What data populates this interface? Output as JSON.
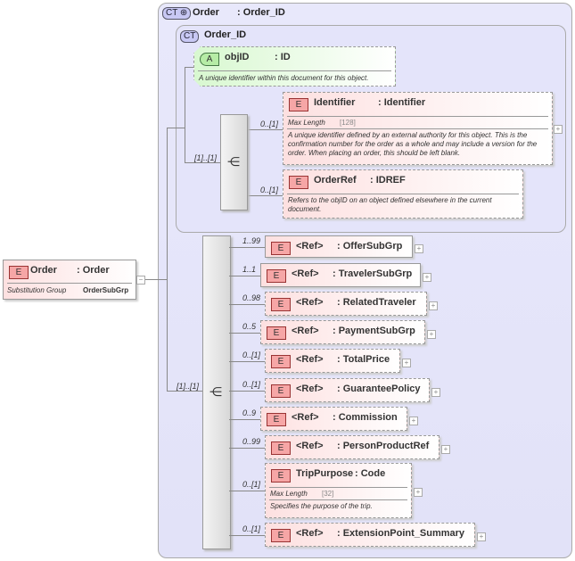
{
  "root": {
    "badge": "E",
    "name": "Order",
    "type": ": Order",
    "subst_label": "Substitution Group",
    "subst_value": "OrderSubGrp"
  },
  "outer_ct": {
    "badge": "CT",
    "name": "Order",
    "type": ": Order_ID"
  },
  "inner_ct": {
    "badge": "CT",
    "name": "Order_ID"
  },
  "attribute": {
    "badge": "A",
    "name": "objID",
    "type": ": ID",
    "doc": "A unique identifier within this document for this object."
  },
  "upper_sequence": {
    "cardinality": "[1]..[1]"
  },
  "identifier": {
    "badge": "E",
    "name": "Identifier",
    "type": ": Identifier",
    "cardinality": "0..[1]",
    "facet_label": "Max Length",
    "facet_value": "[128]",
    "doc": "A unique identifier defined by an external authority for this object.  This is the confirmation number for the order as a whole and may include a version for the order.  When placing an order, this should be left blank."
  },
  "orderref": {
    "badge": "E",
    "name": "OrderRef",
    "type": ": IDREF",
    "cardinality": "0..[1]",
    "doc": "Refers to the objID on an object defined elsewhere in the current document."
  },
  "lower_sequence": {
    "cardinality": "[1]..[1]"
  },
  "items": [
    {
      "name": "<Ref>",
      "type": ": OfferSubGrp",
      "cardinality": "1..99",
      "solid": true
    },
    {
      "name": "<Ref>",
      "type": ": TravelerSubGrp",
      "cardinality": "1..1",
      "solid": true
    },
    {
      "name": "<Ref>",
      "type": ": RelatedTraveler",
      "cardinality": "0..98",
      "solid": false
    },
    {
      "name": "<Ref>",
      "type": ": PaymentSubGrp",
      "cardinality": "0..5",
      "solid": false
    },
    {
      "name": "<Ref>",
      "type": ": TotalPrice",
      "cardinality": "0..[1]",
      "solid": false
    },
    {
      "name": "<Ref>",
      "type": ": GuaranteePolicy",
      "cardinality": "0..[1]",
      "solid": false
    },
    {
      "name": "<Ref>",
      "type": ": Commission",
      "cardinality": "0..9",
      "solid": false
    },
    {
      "name": "<Ref>",
      "type": ": PersonProductRef",
      "cardinality": "0..99",
      "solid": false
    },
    {
      "name": "TripPurpose",
      "type": ": Code",
      "cardinality": "0..[1]",
      "solid": false,
      "facet_label": "Max Length",
      "facet_value": "[32]",
      "doc": "Specifies the purpose of the trip."
    },
    {
      "name": "<Ref>",
      "type": ": ExtensionPoint_Summary",
      "cardinality": "0..[1]",
      "solid": false
    }
  ]
}
